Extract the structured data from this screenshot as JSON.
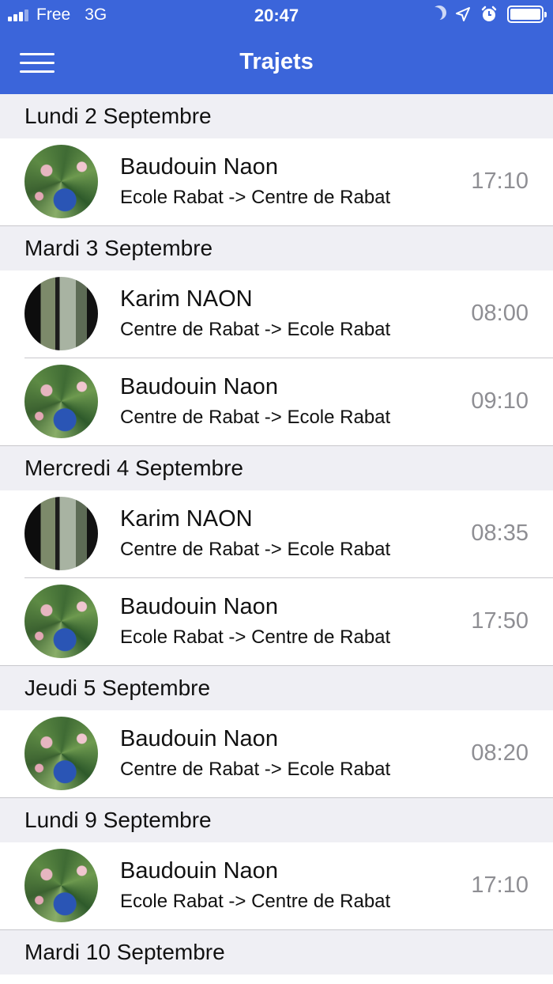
{
  "status_bar": {
    "carrier": "Free",
    "network": "3G",
    "time": "20:47",
    "icons": [
      "signal-icon",
      "moon-icon",
      "location-icon",
      "alarm-icon",
      "battery-icon"
    ]
  },
  "navbar": {
    "title": "Trajets",
    "menu_icon": "hamburger-menu-icon",
    "background": "#3b65da"
  },
  "sections": [
    {
      "date": "Lundi 2 Septembre",
      "trips": [
        {
          "name": "Baudouin Naon",
          "route": "Ecole Rabat -> Centre de Rabat",
          "time": "17:10",
          "avatar": "plant"
        }
      ]
    },
    {
      "date": "Mardi 3 Septembre",
      "trips": [
        {
          "name": "Karim NAON",
          "route": "Centre de Rabat -> Ecole Rabat",
          "time": "08:00",
          "avatar": "window"
        },
        {
          "name": "Baudouin Naon",
          "route": "Centre de Rabat -> Ecole Rabat",
          "time": "09:10",
          "avatar": "plant"
        }
      ]
    },
    {
      "date": "Mercredi 4 Septembre",
      "trips": [
        {
          "name": "Karim NAON",
          "route": "Centre de Rabat -> Ecole Rabat",
          "time": "08:35",
          "avatar": "window"
        },
        {
          "name": "Baudouin Naon",
          "route": "Ecole Rabat -> Centre de Rabat",
          "time": "17:50",
          "avatar": "plant"
        }
      ]
    },
    {
      "date": "Jeudi 5 Septembre",
      "trips": [
        {
          "name": "Baudouin Naon",
          "route": "Centre de Rabat -> Ecole Rabat",
          "time": "08:20",
          "avatar": "plant"
        }
      ]
    },
    {
      "date": "Lundi 9 Septembre",
      "trips": [
        {
          "name": "Baudouin Naon",
          "route": "Ecole Rabat -> Centre de Rabat",
          "time": "17:10",
          "avatar": "plant"
        }
      ]
    },
    {
      "date": "Mardi 10 Septembre",
      "trips": []
    }
  ]
}
